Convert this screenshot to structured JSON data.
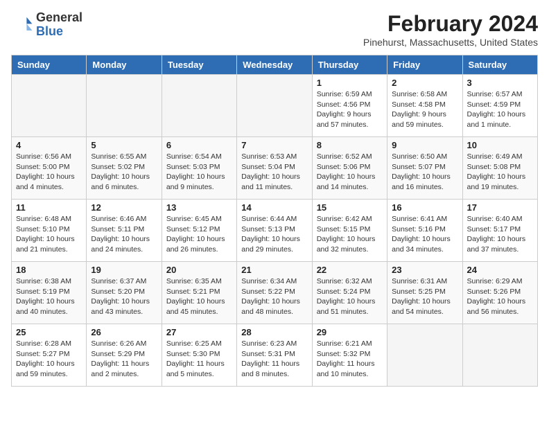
{
  "header": {
    "logo_general": "General",
    "logo_blue": "Blue",
    "main_title": "February 2024",
    "subtitle": "Pinehurst, Massachusetts, United States"
  },
  "days_of_week": [
    "Sunday",
    "Monday",
    "Tuesday",
    "Wednesday",
    "Thursday",
    "Friday",
    "Saturday"
  ],
  "weeks": [
    [
      {
        "day": "",
        "info": ""
      },
      {
        "day": "",
        "info": ""
      },
      {
        "day": "",
        "info": ""
      },
      {
        "day": "",
        "info": ""
      },
      {
        "day": "1",
        "info": "Sunrise: 6:59 AM\nSunset: 4:56 PM\nDaylight: 9 hours and 57 minutes."
      },
      {
        "day": "2",
        "info": "Sunrise: 6:58 AM\nSunset: 4:58 PM\nDaylight: 9 hours and 59 minutes."
      },
      {
        "day": "3",
        "info": "Sunrise: 6:57 AM\nSunset: 4:59 PM\nDaylight: 10 hours and 1 minute."
      }
    ],
    [
      {
        "day": "4",
        "info": "Sunrise: 6:56 AM\nSunset: 5:00 PM\nDaylight: 10 hours and 4 minutes."
      },
      {
        "day": "5",
        "info": "Sunrise: 6:55 AM\nSunset: 5:02 PM\nDaylight: 10 hours and 6 minutes."
      },
      {
        "day": "6",
        "info": "Sunrise: 6:54 AM\nSunset: 5:03 PM\nDaylight: 10 hours and 9 minutes."
      },
      {
        "day": "7",
        "info": "Sunrise: 6:53 AM\nSunset: 5:04 PM\nDaylight: 10 hours and 11 minutes."
      },
      {
        "day": "8",
        "info": "Sunrise: 6:52 AM\nSunset: 5:06 PM\nDaylight: 10 hours and 14 minutes."
      },
      {
        "day": "9",
        "info": "Sunrise: 6:50 AM\nSunset: 5:07 PM\nDaylight: 10 hours and 16 minutes."
      },
      {
        "day": "10",
        "info": "Sunrise: 6:49 AM\nSunset: 5:08 PM\nDaylight: 10 hours and 19 minutes."
      }
    ],
    [
      {
        "day": "11",
        "info": "Sunrise: 6:48 AM\nSunset: 5:10 PM\nDaylight: 10 hours and 21 minutes."
      },
      {
        "day": "12",
        "info": "Sunrise: 6:46 AM\nSunset: 5:11 PM\nDaylight: 10 hours and 24 minutes."
      },
      {
        "day": "13",
        "info": "Sunrise: 6:45 AM\nSunset: 5:12 PM\nDaylight: 10 hours and 26 minutes."
      },
      {
        "day": "14",
        "info": "Sunrise: 6:44 AM\nSunset: 5:13 PM\nDaylight: 10 hours and 29 minutes."
      },
      {
        "day": "15",
        "info": "Sunrise: 6:42 AM\nSunset: 5:15 PM\nDaylight: 10 hours and 32 minutes."
      },
      {
        "day": "16",
        "info": "Sunrise: 6:41 AM\nSunset: 5:16 PM\nDaylight: 10 hours and 34 minutes."
      },
      {
        "day": "17",
        "info": "Sunrise: 6:40 AM\nSunset: 5:17 PM\nDaylight: 10 hours and 37 minutes."
      }
    ],
    [
      {
        "day": "18",
        "info": "Sunrise: 6:38 AM\nSunset: 5:19 PM\nDaylight: 10 hours and 40 minutes."
      },
      {
        "day": "19",
        "info": "Sunrise: 6:37 AM\nSunset: 5:20 PM\nDaylight: 10 hours and 43 minutes."
      },
      {
        "day": "20",
        "info": "Sunrise: 6:35 AM\nSunset: 5:21 PM\nDaylight: 10 hours and 45 minutes."
      },
      {
        "day": "21",
        "info": "Sunrise: 6:34 AM\nSunset: 5:22 PM\nDaylight: 10 hours and 48 minutes."
      },
      {
        "day": "22",
        "info": "Sunrise: 6:32 AM\nSunset: 5:24 PM\nDaylight: 10 hours and 51 minutes."
      },
      {
        "day": "23",
        "info": "Sunrise: 6:31 AM\nSunset: 5:25 PM\nDaylight: 10 hours and 54 minutes."
      },
      {
        "day": "24",
        "info": "Sunrise: 6:29 AM\nSunset: 5:26 PM\nDaylight: 10 hours and 56 minutes."
      }
    ],
    [
      {
        "day": "25",
        "info": "Sunrise: 6:28 AM\nSunset: 5:27 PM\nDaylight: 10 hours and 59 minutes."
      },
      {
        "day": "26",
        "info": "Sunrise: 6:26 AM\nSunset: 5:29 PM\nDaylight: 11 hours and 2 minutes."
      },
      {
        "day": "27",
        "info": "Sunrise: 6:25 AM\nSunset: 5:30 PM\nDaylight: 11 hours and 5 minutes."
      },
      {
        "day": "28",
        "info": "Sunrise: 6:23 AM\nSunset: 5:31 PM\nDaylight: 11 hours and 8 minutes."
      },
      {
        "day": "29",
        "info": "Sunrise: 6:21 AM\nSunset: 5:32 PM\nDaylight: 11 hours and 10 minutes."
      },
      {
        "day": "",
        "info": ""
      },
      {
        "day": "",
        "info": ""
      }
    ]
  ]
}
